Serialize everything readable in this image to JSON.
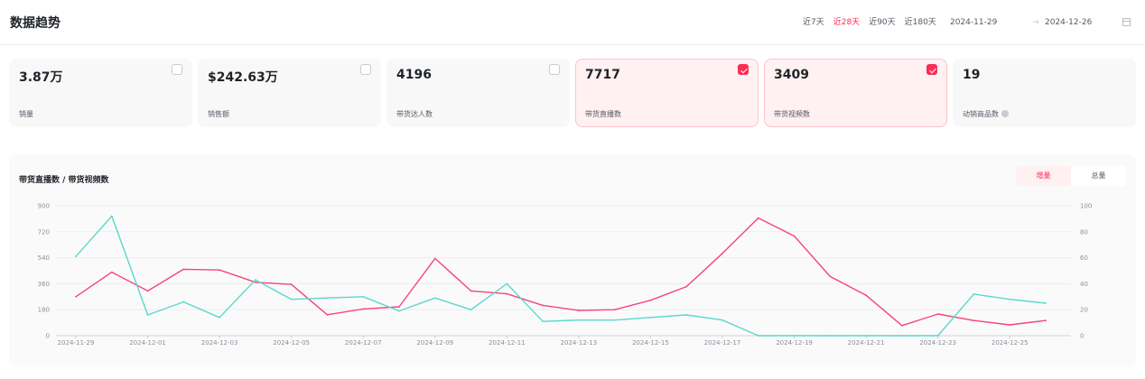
{
  "header": {
    "title": "数据趋势",
    "ranges": [
      "近7天",
      "近28天",
      "近90天",
      "近180天"
    ],
    "active_range": "近28天",
    "date_start": "2024-11-29",
    "date_separator": "→",
    "date_end": "2024-12-26"
  },
  "metrics": [
    {
      "value": "3.87万",
      "label": "销量",
      "checked": false
    },
    {
      "value": "$242.63万",
      "label": "销售额",
      "checked": false
    },
    {
      "value": "4196",
      "label": "带货达人数",
      "checked": false
    },
    {
      "value": "7717",
      "label": "带货直播数",
      "checked": true
    },
    {
      "value": "3409",
      "label": "带货视频数",
      "checked": true
    },
    {
      "value": "19",
      "label": "动销商品数",
      "checked": null
    }
  ],
  "chart_panel": {
    "title": "带货直播数 / 带货视频数",
    "toggle": [
      "增量",
      "总量"
    ],
    "active_toggle": "增量"
  },
  "colors": {
    "accent": "#fe2c55",
    "series_live": "#f5457a",
    "series_video": "#5ad8cd"
  },
  "chart_data": {
    "type": "line",
    "x": [
      "2024-11-29",
      "2024-11-30",
      "2024-12-01",
      "2024-12-02",
      "2024-12-03",
      "2024-12-04",
      "2024-12-05",
      "2024-12-06",
      "2024-12-07",
      "2024-12-08",
      "2024-12-09",
      "2024-12-10",
      "2024-12-11",
      "2024-12-12",
      "2024-12-13",
      "2024-12-14",
      "2024-12-15",
      "2024-12-16",
      "2024-12-17",
      "2024-12-18",
      "2024-12-19",
      "2024-12-20",
      "2024-12-21",
      "2024-12-22",
      "2024-12-23",
      "2024-12-24",
      "2024-12-25",
      "2024-12-26"
    ],
    "x_ticks": [
      "2024-11-29",
      "2024-12-01",
      "2024-12-03",
      "2024-12-05",
      "2024-12-07",
      "2024-12-09",
      "2024-12-11",
      "2024-12-13",
      "2024-12-15",
      "2024-12-17",
      "2024-12-19",
      "2024-12-21",
      "2024-12-23",
      "2024-12-25"
    ],
    "y_left": {
      "ticks": [
        0,
        180,
        360,
        540,
        720,
        900
      ],
      "range": [
        0,
        900
      ]
    },
    "y_right": {
      "ticks": [
        0,
        20,
        40,
        60,
        80,
        100
      ],
      "range": [
        0,
        100
      ]
    },
    "series": [
      {
        "axis": "left",
        "color": "#f5457a",
        "values": [
          270,
          440,
          310,
          460,
          455,
          370,
          355,
          145,
          185,
          200,
          535,
          310,
          290,
          210,
          175,
          180,
          245,
          340,
          570,
          815,
          690,
          410,
          280,
          70,
          150,
          105,
          75,
          105
        ]
      },
      {
        "axis": "right",
        "color": "#5ad8cd",
        "values": [
          61,
          92,
          16,
          26,
          14,
          43,
          28,
          29,
          30,
          19,
          29,
          20,
          40,
          11,
          12,
          12,
          14,
          16,
          12,
          0,
          0,
          0,
          0,
          0,
          0,
          32,
          28,
          25
        ]
      }
    ],
    "grid": true,
    "legend": "none"
  }
}
